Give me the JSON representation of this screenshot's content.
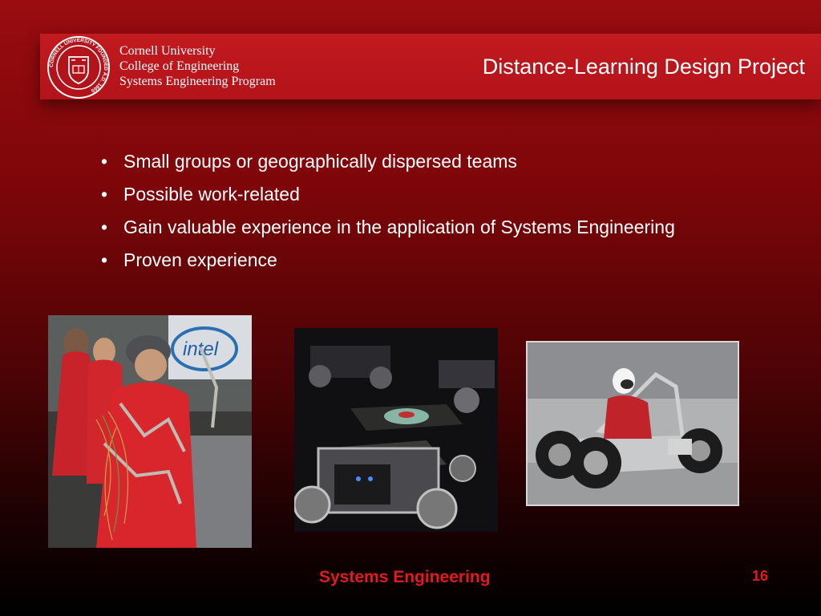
{
  "header": {
    "org_line1": "Cornell University",
    "org_line2": "College of Engineering",
    "org_line3": "Systems Engineering Program",
    "seal_text": "CORNELL UNIVERSITY FOUNDED A.D. 1865",
    "title": "Distance-Learning Design Project"
  },
  "bullets": [
    "Small groups or geographically dispersed teams",
    "Possible work-related",
    "Gain valuable experience in the application of Systems Engineering",
    "Proven experience"
  ],
  "bullet_glyph": "•",
  "photos": {
    "left_photo_text": "intel"
  },
  "footer": {
    "label": "Systems Engineering",
    "page_number": "16"
  },
  "colors": {
    "header_bar": "#b3131a",
    "footer_text": "#e21a1f",
    "background_top": "#9a0c10",
    "background_bottom": "#000000"
  }
}
